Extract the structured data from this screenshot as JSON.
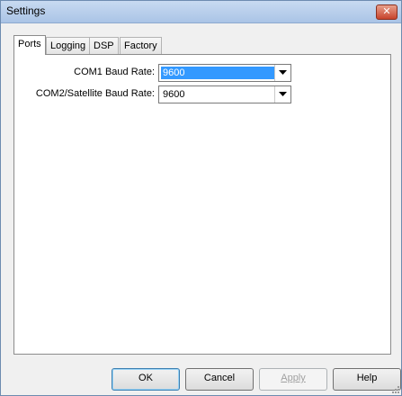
{
  "window": {
    "title": "Settings"
  },
  "tabs": [
    {
      "label": "Ports",
      "active": true
    },
    {
      "label": "Logging",
      "active": false
    },
    {
      "label": "DSP",
      "active": false
    },
    {
      "label": "Factory",
      "active": false
    }
  ],
  "ports": {
    "com1": {
      "label": "COM1 Baud Rate:",
      "value": "9600",
      "selected": true
    },
    "com2": {
      "label": "COM2/Satellite Baud Rate:",
      "value": "9600",
      "selected": false
    }
  },
  "buttons": {
    "ok": "OK",
    "cancel": "Cancel",
    "apply": "Apply",
    "help": "Help"
  },
  "icons": {
    "close": "close-icon",
    "dropdown": "chevron-down-icon"
  },
  "colors": {
    "selection": "#3399ff",
    "titlebar": "#aac4e6",
    "close_button": "#c7432c"
  }
}
